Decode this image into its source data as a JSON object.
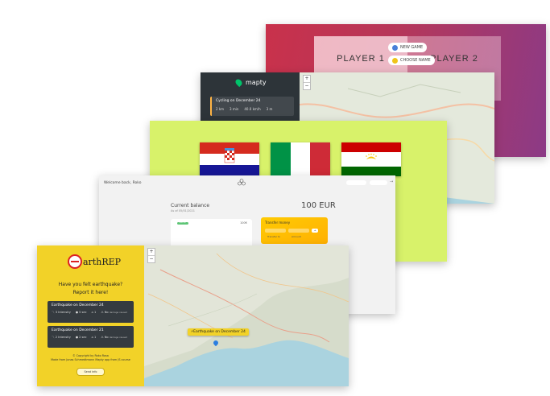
{
  "pig_game": {
    "player1": "PLAYER 1",
    "player2": "PLAYER 2",
    "new_game": "NEW GAME",
    "choose_name": "CHOOSE NAME",
    "colors": {
      "start": "#c9314b",
      "end": "#8c3a86"
    }
  },
  "mapty": {
    "brand": "mapty",
    "workout": {
      "title": "Cycling on December 24",
      "stats": [
        "2 km",
        "3 min",
        "40.0 km/h",
        "3 m"
      ]
    },
    "zoom": [
      "+",
      "−"
    ]
  },
  "flags": {
    "items": [
      "croatia-flag",
      "italy-flag",
      "tajikistan-flag"
    ]
  },
  "bankist": {
    "welcome": "Welcome back, Roko",
    "balance_label": "Current balance",
    "balance_date": "As of 05/01/2021",
    "balance_value": "100 EUR",
    "deposit_badge": "DEPOSIT",
    "movement_amount": "100€",
    "transfer_title": "Transfer money",
    "transfer_to_label": "Transfer to",
    "amount_label": "Amount",
    "go_button": "→"
  },
  "earthrep": {
    "brand": "arthREP",
    "question": "Have you felt earthquake?",
    "prompt": "Report it here!",
    "reports": [
      {
        "title": "Earthquake on December 24",
        "stats": [
          "3 Intensity",
          "5 sec",
          "1",
          "No",
          "damage caused"
        ]
      },
      {
        "title": "Earthquake on December 21",
        "stats": [
          "2 Intensity",
          "2 sec",
          "1",
          "No",
          "damage caused"
        ]
      }
    ],
    "copyright": "© Copyright by Roko Rosa",
    "credit": "Made from Jonas Schmedtmann Mapty app from JS course",
    "donate_button": "Send info",
    "popup": "Earthquake on December 24",
    "zoom": [
      "+",
      "−"
    ]
  }
}
